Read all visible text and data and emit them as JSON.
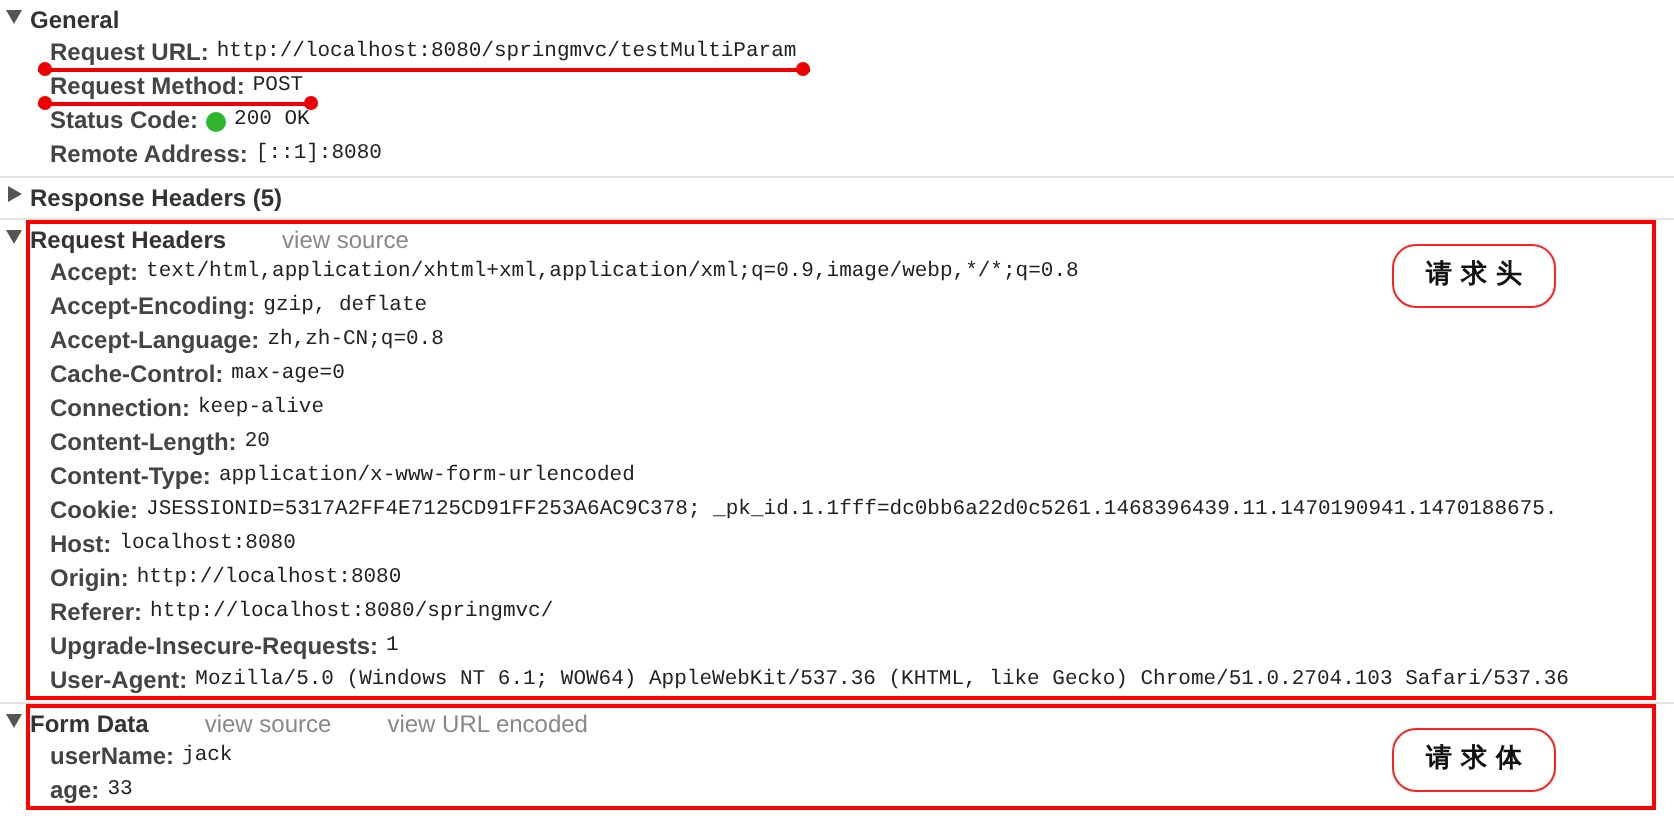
{
  "sections": [
    {
      "title": "General",
      "expanded": true,
      "rows": [
        {
          "key": "Request URL:",
          "value": "http://localhost:8080/springmvc/testMultiParam",
          "underlined": true
        },
        {
          "key": "Request Method:",
          "value": "POST",
          "underlined": true
        },
        {
          "key": "Status Code:",
          "value": "200 OK",
          "color": "#2db52d"
        },
        {
          "key": "Remote Address:",
          "value": "[::1]:8080"
        }
      ]
    },
    {
      "title": "Response Headers (5)",
      "expanded": false
    },
    {
      "title": "Request Headers",
      "expanded": true,
      "highlighted": true,
      "callout": "请 求 头",
      "links": [
        "view source"
      ],
      "rows": [
        {
          "key": "Accept:",
          "value": "text/html,application/xhtml+xml,application/xml;q=0.9,image/webp,*/*;q=0.8"
        },
        {
          "key": "Accept-Encoding:",
          "value": "gzip, deflate"
        },
        {
          "key": "Accept-Language:",
          "value": "zh,zh-CN;q=0.8"
        },
        {
          "key": "Cache-Control:",
          "value": "max-age=0"
        },
        {
          "key": "Connection:",
          "value": "keep-alive"
        },
        {
          "key": "Content-Length:",
          "value": "20"
        },
        {
          "key": "Content-Type:",
          "value": "application/x-www-form-urlencoded"
        },
        {
          "key": "Cookie:",
          "value": "JSESSIONID=5317A2FF4E7125CD91FF253A6AC9C378; _pk_id.1.1fff=dc0bb6a22d0c5261.1468396439.11.1470190941.1470188675."
        },
        {
          "key": "Host:",
          "value": "localhost:8080"
        },
        {
          "key": "Origin:",
          "value": "http://localhost:8080"
        },
        {
          "key": "Referer:",
          "value": "http://localhost:8080/springmvc/"
        },
        {
          "key": "Upgrade-Insecure-Requests:",
          "value": "1"
        },
        {
          "key": "User-Agent:",
          "value": "Mozilla/5.0 (Windows NT 6.1; WOW64) AppleWebKit/537.36 (KHTML, like Gecko) Chrome/51.0.2704.103 Safari/537.36"
        }
      ]
    },
    {
      "title": "Form Data",
      "expanded": true,
      "highlighted": true,
      "callout": "请 求 体",
      "links": [
        "view source",
        "view URL encoded"
      ],
      "rows": [
        {
          "key": "userName:",
          "value": "jack"
        },
        {
          "key": "age:",
          "value": "33"
        }
      ]
    }
  ]
}
